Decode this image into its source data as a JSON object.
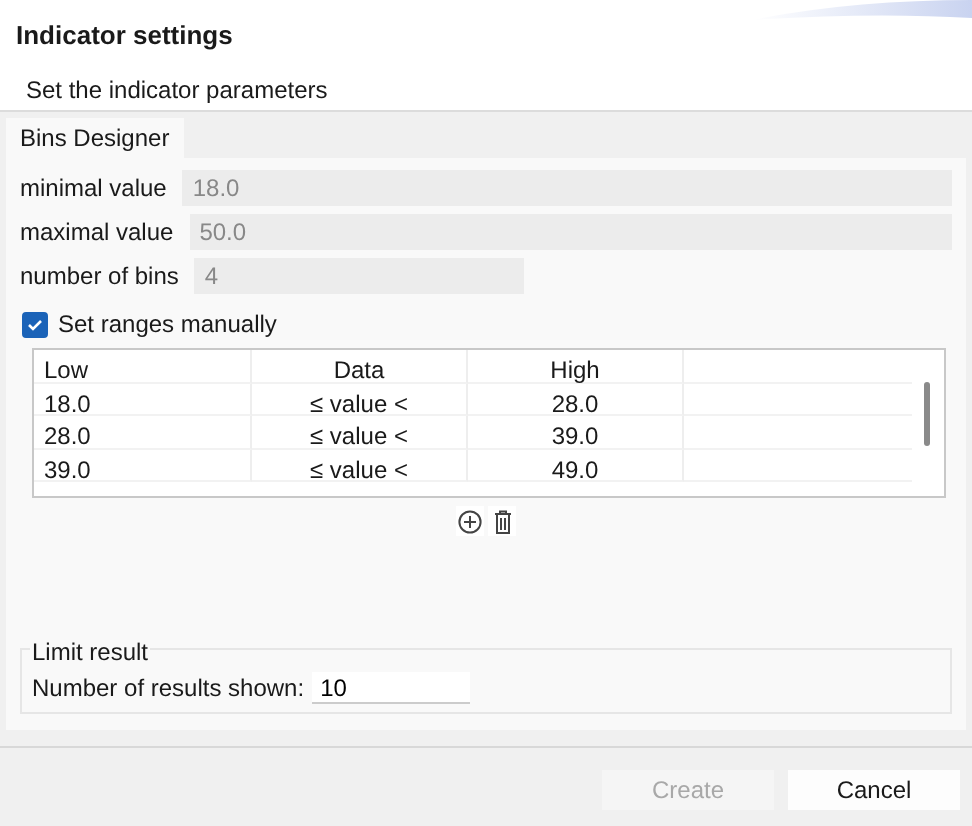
{
  "dialog": {
    "title": "Indicator settings",
    "subtitle": "Set the indicator parameters"
  },
  "tabs": [
    {
      "label": "Bins Designer",
      "selected": true
    }
  ],
  "fields": [
    {
      "label": "minimal value",
      "value": "18.0",
      "disabled": true
    },
    {
      "label": "maximal value",
      "value": "50.0",
      "disabled": true
    },
    {
      "label": "number of bins",
      "value": "4",
      "disabled": true
    }
  ],
  "set_ranges_manually": {
    "label": "Set ranges manually",
    "checked": true
  },
  "table": {
    "columns": [
      "Low",
      "Data",
      "High"
    ],
    "rows": [
      [
        "18.0",
        "≤ value <",
        "28.0"
      ],
      [
        "28.0",
        "≤ value <",
        "39.0"
      ],
      [
        "39.0",
        "≤ value <",
        "49.0"
      ]
    ]
  },
  "limit_result": {
    "legend": "Limit result",
    "label": "Number of results shown:",
    "value": "10"
  },
  "buttons": [
    {
      "label": "Create",
      "disabled": true
    },
    {
      "label": "Cancel",
      "disabled": false
    }
  ]
}
